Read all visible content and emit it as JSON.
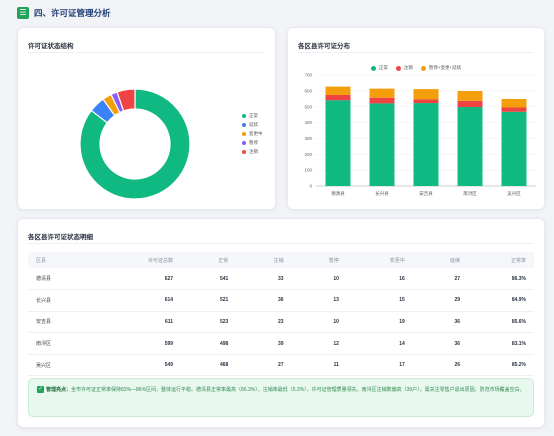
{
  "section": {
    "title": "四、许可证管理分析"
  },
  "pie_card": {
    "title": "许可证状态结构",
    "legend": [
      {
        "label": "正常",
        "color": "#10b981"
      },
      {
        "label": "延续",
        "color": "#3b82f6"
      },
      {
        "label": "变更中",
        "color": "#f59e0b"
      },
      {
        "label": "暂停",
        "color": "#8b5cf6"
      },
      {
        "label": "注销",
        "color": "#ef4444"
      }
    ]
  },
  "bar_card": {
    "title": "各区县许可证分布",
    "legend": [
      {
        "label": "正常",
        "color": "#10b981"
      },
      {
        "label": "注销",
        "color": "#ef4444"
      },
      {
        "label": "暂停+变更+延续",
        "color": "#f59e0b"
      }
    ]
  },
  "chart_data": [
    {
      "type": "pie",
      "donut": true,
      "labels": [
        "正常",
        "延续",
        "变更中",
        "暂停",
        "注销"
      ],
      "values": [
        2551,
        142,
        80,
        56,
        158
      ],
      "colors": [
        "#10b981",
        "#3b82f6",
        "#f59e0b",
        "#8b5cf6",
        "#ef4444"
      ]
    },
    {
      "type": "bar",
      "stacked": true,
      "categories": [
        "德清县",
        "长兴县",
        "安吉县",
        "南浔区",
        "吴兴区"
      ],
      "series": [
        {
          "name": "正常",
          "values": [
            541,
            521,
            523,
            498,
            468
          ],
          "color": "#10b981"
        },
        {
          "name": "注销",
          "values": [
            33,
            36,
            23,
            39,
            27
          ],
          "color": "#ef4444"
        },
        {
          "name": "暂停+变更+延续",
          "values": [
            53,
            57,
            65,
            62,
            54
          ],
          "color": "#f59e0b"
        }
      ],
      "ylim": [
        0,
        700
      ],
      "yticks": [
        0,
        100,
        200,
        300,
        400,
        500,
        600,
        700
      ],
      "grid": true,
      "legend_position": "top"
    }
  ],
  "table_card": {
    "title": "各区县许可证状态明细",
    "columns": [
      "区县",
      "许可证总数",
      "正常",
      "注销",
      "暂停",
      "变更中",
      "延续",
      "正常率"
    ],
    "rows": [
      [
        "德清县",
        "627",
        "541",
        "33",
        "10",
        "16",
        "27",
        "86.3%"
      ],
      [
        "长兴县",
        "614",
        "521",
        "36",
        "13",
        "15",
        "29",
        "84.9%"
      ],
      [
        "安吉县",
        "611",
        "523",
        "23",
        "10",
        "19",
        "36",
        "85.6%"
      ],
      [
        "南浔区",
        "599",
        "498",
        "39",
        "12",
        "14",
        "36",
        "83.1%"
      ],
      [
        "吴兴区",
        "549",
        "468",
        "27",
        "11",
        "17",
        "26",
        "85.2%"
      ]
    ],
    "note_label": "管理亮点：",
    "note_text": "全市许可证正常率保持83%—86%区间，整体运行平稳。德清县正常率最高（86.3%），注销率最低（5.3%），许可证管理质量领先。南浔区注销数偏高（39户），需关注零售户退出原因，防范市场覆盖空白。"
  }
}
